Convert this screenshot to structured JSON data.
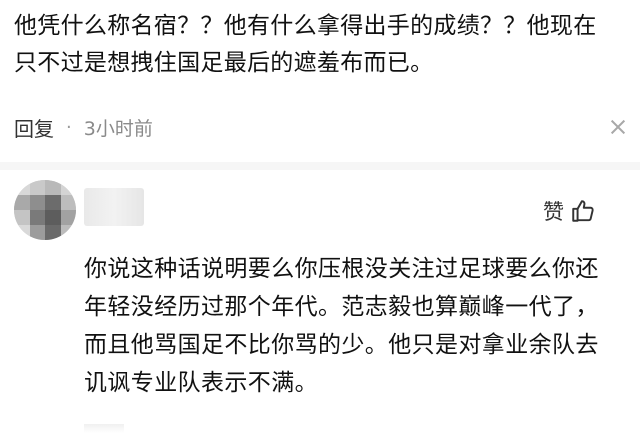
{
  "first_comment": {
    "text": "他凭什么称名宿？？他有什么拿得出手的成绩？？他现在只不过是想拽住国足最后的遮羞布而已。",
    "reply_label": "回复",
    "separator": "·",
    "time": "3小时前"
  },
  "second_comment": {
    "like_label": "赞",
    "text": "你说这种话说明要么你压根没关注过足球要么你还年轻没经历过那个年代。范志毅也算巅峰一代了，而且他骂国足不比你骂的少。他只是对拿业余队去讥讽专业队表示不满。"
  },
  "icons": {
    "close": "close-icon",
    "like": "thumbs-up-icon"
  },
  "colors": {
    "text": "#111111",
    "muted": "#8a8a8a",
    "divider": "#f6f6f6"
  }
}
